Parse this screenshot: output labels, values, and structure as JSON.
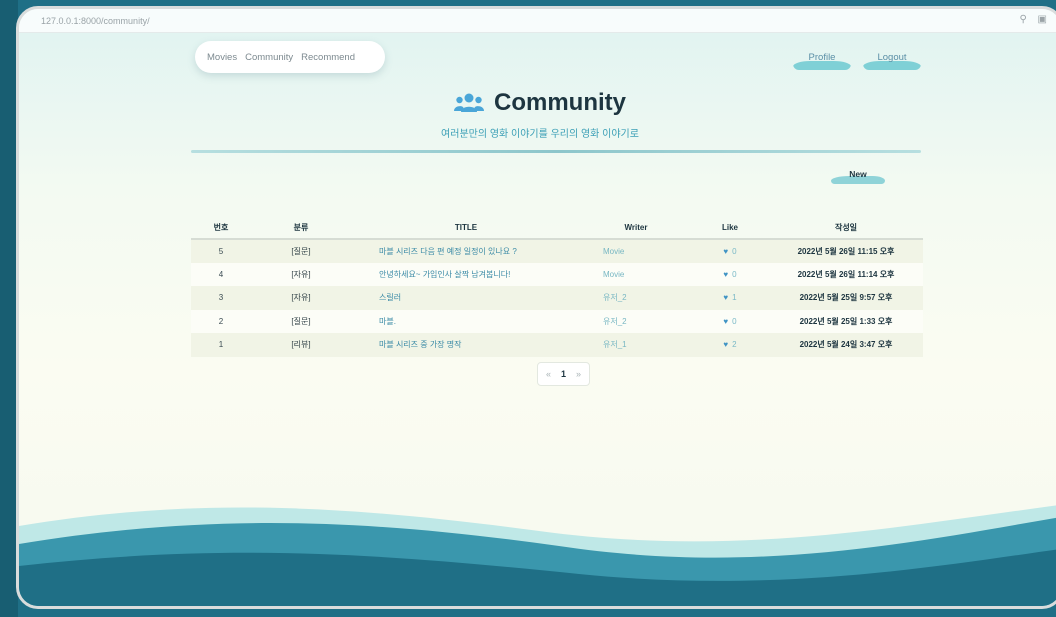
{
  "browser": {
    "url": "127.0.0.1:8000/community/",
    "icons": [
      "search-icon",
      "translate-icon"
    ]
  },
  "nav": {
    "links": [
      "Movies",
      "Community",
      "Recommend"
    ],
    "profile_label": "Profile",
    "logout_label": "Logout"
  },
  "header": {
    "title": "Community",
    "title_icon": "users-icon",
    "subtitle": "여러분만의 영화 이야기를 우리의 영화 이야기로"
  },
  "actions": {
    "new_label": "New"
  },
  "table": {
    "columns": [
      "번호",
      "분류",
      "TITLE",
      "Writer",
      "Like",
      "작성일"
    ],
    "rows": [
      {
        "no": "5",
        "category": "[질문]",
        "title": "마블 시리즈 다음 편 예정 일정이 있나요 ?",
        "writer": "Movie",
        "likes": "0",
        "date": "2022년 5월 26일 11:15 오후"
      },
      {
        "no": "4",
        "category": "[자유]",
        "title": "안녕하세요~ 가입인사 살짝 남겨봅니다!",
        "writer": "Movie",
        "likes": "0",
        "date": "2022년 5월 26일 11:14 오후"
      },
      {
        "no": "3",
        "category": "[자유]",
        "title": "스릴러",
        "writer": "유저_2",
        "likes": "1",
        "date": "2022년 5월 25일 9:57 오후"
      },
      {
        "no": "2",
        "category": "[질문]",
        "title": "마블.",
        "writer": "유저_2",
        "likes": "0",
        "date": "2022년 5월 25일 1:33 오후"
      },
      {
        "no": "1",
        "category": "[리뷰]",
        "title": "마블 시리즈 중 가장 명작",
        "writer": "유저_1",
        "likes": "2",
        "date": "2022년 5월 24일 3:47 오후"
      }
    ]
  },
  "pagination": {
    "prev": "«",
    "current": "1",
    "next": "»"
  },
  "colors": {
    "accent": "#3b9fb6",
    "wave_dark": "#1f6f86",
    "wave_light": "#7fd0d6",
    "text_dark": "#1d3540"
  }
}
